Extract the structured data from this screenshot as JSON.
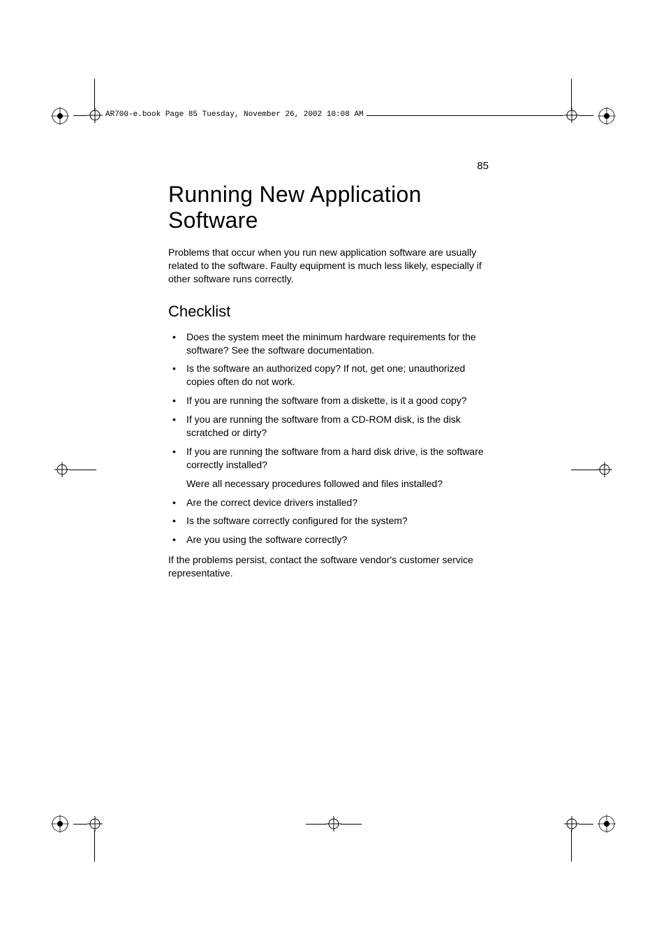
{
  "header": {
    "line": "AR700-e.book  Page 85  Tuesday, November 26, 2002  10:08 AM"
  },
  "pageNumber": "85",
  "mainTitle": "Running New Application Software",
  "introText": "Problems that occur when you run new application software are usually related to the software. Faulty equipment is much less likely, especially if other software runs correctly.",
  "sectionTitle": "Checklist",
  "checklist": {
    "item0": "Does the system meet the minimum hardware requirements for the software? See the software documentation.",
    "item1": "Is the software an authorized copy? If not, get one; unauthorized copies often do not work.",
    "item2": "If you are running the software from a diskette, is it a good copy?",
    "item3": "If you are running the software from a CD-ROM disk, is the disk scratched or dirty?",
    "item4": "If you are running the software from a hard disk drive, is the software correctly installed?",
    "item4followup": "Were all necessary procedures followed and files installed?",
    "item5": "Are the correct device drivers installed?",
    "item6": "Is the software correctly configured for the system?",
    "item7": "Are you using the software correctly?"
  },
  "closingText": "If the problems persist, contact the software vendor's customer service representative."
}
